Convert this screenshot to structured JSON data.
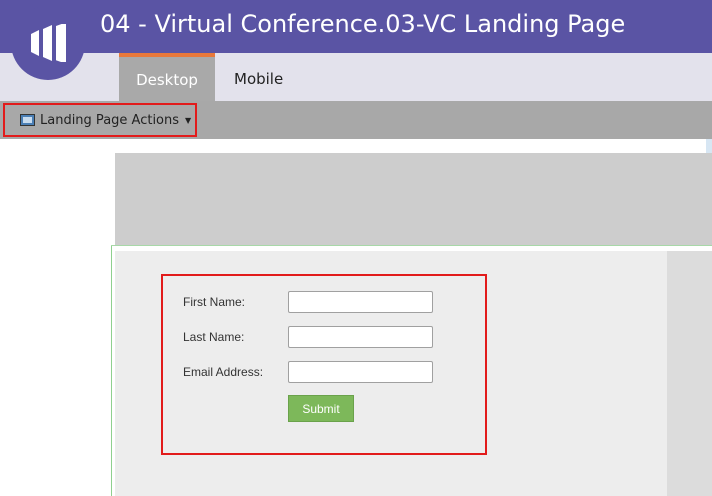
{
  "header": {
    "title": "04 - Virtual Conference.03-VC Landing Page",
    "logo_icon": "marketo-logo-icon"
  },
  "tabs": [
    {
      "label": "Desktop",
      "active": true
    },
    {
      "label": "Mobile",
      "active": false
    }
  ],
  "toolbar": {
    "actions_label": "Landing Page Actions",
    "actions_icon": "landing-page-icon"
  },
  "form": {
    "fields": [
      {
        "label": "First Name:",
        "value": ""
      },
      {
        "label": "Last Name:",
        "value": ""
      },
      {
        "label": "Email Address:",
        "value": ""
      }
    ],
    "submit_label": "Submit"
  },
  "colors": {
    "header_purple": "#5a54a4",
    "active_tab_accent": "#e8783a",
    "highlight_red": "#e21b1b",
    "submit_green": "#7db85a"
  }
}
